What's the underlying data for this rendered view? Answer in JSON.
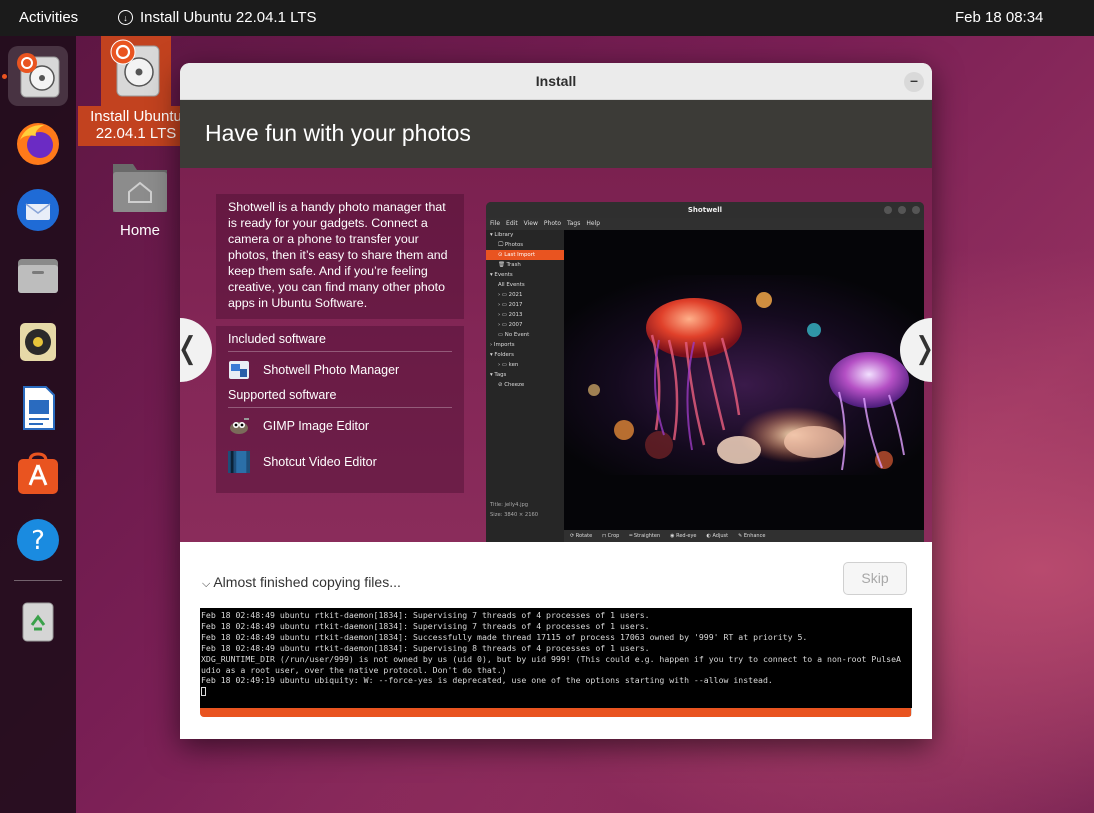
{
  "topbar": {
    "activities": "Activities",
    "app_name": "Install Ubuntu 22.04.1 LTS",
    "datetime": "Feb 18  08:34"
  },
  "dock": {
    "items": [
      {
        "name": "install-ubuntu",
        "icon": "ubuntu-installer-icon"
      },
      {
        "name": "firefox",
        "icon": "firefox-icon"
      },
      {
        "name": "thunderbird",
        "icon": "thunderbird-icon"
      },
      {
        "name": "files",
        "icon": "files-icon"
      },
      {
        "name": "rhythmbox",
        "icon": "rhythmbox-icon"
      },
      {
        "name": "libreoffice-writer",
        "icon": "writer-icon"
      },
      {
        "name": "ubuntu-software",
        "icon": "software-icon"
      },
      {
        "name": "help",
        "icon": "help-icon"
      },
      {
        "name": "trash",
        "icon": "trash-icon"
      }
    ]
  },
  "desktop": {
    "install_label": "Install Ubuntu 22.04.1 LTS",
    "home_label": "Home"
  },
  "window": {
    "title": "Install",
    "slide_title": "Have fun with your photos",
    "description": "Shotwell is a handy photo manager that is ready for your gadgets. Connect a camera or a phone to transfer your photos, then it’s easy to share them and keep them safe. And if you’re feeling creative, you can find many other photo apps in Ubuntu Software.",
    "included_heading": "Included software",
    "included": [
      {
        "label": "Shotwell Photo Manager",
        "icon": "shotwell-icon"
      }
    ],
    "supported_heading": "Supported software",
    "supported": [
      {
        "label": "GIMP Image Editor",
        "icon": "gimp-icon"
      },
      {
        "label": "Shotcut Video Editor",
        "icon": "shotcut-icon"
      }
    ],
    "nav_prev": "❬",
    "nav_next": "❭",
    "status": "Almost finished copying files...",
    "skip_label": "Skip",
    "progress_fraction": 0.999,
    "terminal_lines": [
      "Feb 18 02:48:49 ubuntu rtkit-daemon[1834]: Supervising 7 threads of 4 processes of 1 users.",
      "Feb 18 02:48:49 ubuntu rtkit-daemon[1834]: Supervising 7 threads of 4 processes of 1 users.",
      "Feb 18 02:48:49 ubuntu rtkit-daemon[1834]: Successfully made thread 17115 of process 17063 owned by '999' RT at priority 5.",
      "Feb 18 02:48:49 ubuntu rtkit-daemon[1834]: Supervising 8 threads of 4 processes of 1 users.",
      "XDG_RUNTIME_DIR (/run/user/999) is not owned by us (uid 0), but by uid 999! (This could e.g. happen if you try to connect to a non-root PulseA",
      "udio as a root user, over the native protocol. Don't do that.)",
      "Feb 18 02:49:19 ubuntu ubiquity: W: --force-yes is deprecated, use one of the options starting with --allow instead."
    ]
  },
  "shotwell": {
    "title": "Shotwell",
    "menu": [
      "File",
      "Edit",
      "View",
      "Photo",
      "Tags",
      "Help"
    ],
    "sidebar": [
      {
        "label": "▾ Library",
        "indent": 0,
        "selected": false
      },
      {
        "label": "🖵 Photos",
        "indent": 1,
        "selected": false
      },
      {
        "label": "⊙ Last Import",
        "indent": 1,
        "selected": true
      },
      {
        "label": "🗑 Trash",
        "indent": 1,
        "selected": false
      },
      {
        "label": "▾ Events",
        "indent": 0,
        "selected": false
      },
      {
        "label": "All Events",
        "indent": 1,
        "selected": false
      },
      {
        "label": "› ▭ 2021",
        "indent": 1,
        "selected": false
      },
      {
        "label": "› ▭ 2017",
        "indent": 1,
        "selected": false
      },
      {
        "label": "› ▭ 2013",
        "indent": 1,
        "selected": false
      },
      {
        "label": "› ▭ 2007",
        "indent": 1,
        "selected": false
      },
      {
        "label": "▭ No Event",
        "indent": 1,
        "selected": false
      },
      {
        "label": "› Imports",
        "indent": 0,
        "selected": false
      },
      {
        "label": "▾ Folders",
        "indent": 0,
        "selected": false
      },
      {
        "label": "› ▭ ken",
        "indent": 1,
        "selected": false
      },
      {
        "label": "▾ Tags",
        "indent": 0,
        "selected": false
      },
      {
        "label": "⊘ Cheeze",
        "indent": 1,
        "selected": false
      }
    ],
    "meta_title_label": "Title:",
    "meta_title": "jelly4.jpg",
    "meta_size_label": "Size:",
    "meta_size": "3840 × 2160",
    "toolbar": [
      "⟳ Rotate",
      "⊓ Crop",
      "═ Straighten",
      "◉ Red-eye",
      "◐ Adjust",
      "✎ Enhance"
    ]
  },
  "colors": {
    "accent": "#e95420",
    "header_bg": "#3c3b37",
    "slide_bg": "#842757"
  }
}
